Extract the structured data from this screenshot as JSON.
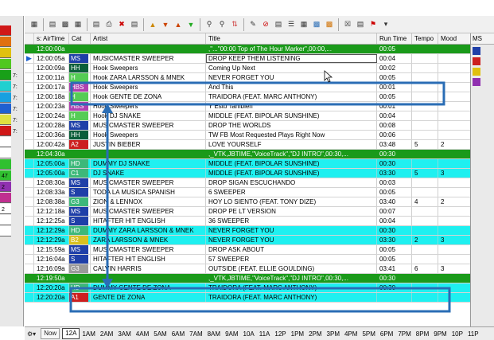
{
  "colors": {
    "green": "#1a9a1a",
    "cyan": "#1ff0f0",
    "annotation": "#2a6db5"
  },
  "columns": {
    "airtime": "s: AirTime",
    "cat": "Cat",
    "artist": "Artist",
    "title": "Title",
    "run": "Run Time",
    "tempo": "Tempo",
    "mood": "Mood"
  },
  "left_panel": {
    "labels": [
      "7:",
      "7:",
      "7:",
      "7:",
      "7:",
      "7:",
      "47",
      "2",
      "2"
    ]
  },
  "rows": [
    {
      "type": "green",
      "time": "12:00:00a",
      "cat": "",
      "cat_color": "",
      "artist": "",
      "title": ",\"...\"00:00 Top of The Hour Marker\",00:00,...",
      "run": "00:05",
      "tempo": "",
      "mood": "",
      "arrow": false,
      "title_box": false
    },
    {
      "type": "white",
      "time": "12:00:05a",
      "cat": "MS",
      "cat_color": "#1f3fa8",
      "artist": "MUSICMASTER SWEEPER",
      "title": "DROP KEEP THEM LISTENING",
      "run": "00:04",
      "tempo": "",
      "mood": "",
      "arrow": true,
      "title_box": true
    },
    {
      "type": "white",
      "time": "12:00:09a",
      "cat": "HH",
      "cat_color": "#0b5e3a",
      "artist": "Hook Sweepers",
      "title": "Coming Up Next",
      "run": "00:02",
      "tempo": "",
      "mood": "",
      "arrow": false,
      "title_box": false
    },
    {
      "type": "white",
      "time": "12:00:11a",
      "cat": "H",
      "cat_color": "#55cc55",
      "artist": "Hook ZARA LARSSON & MNEK",
      "title": "NEVER FORGET YOU",
      "run": "00:05",
      "tempo": "",
      "mood": "",
      "arrow": false,
      "title_box": false
    },
    {
      "type": "white",
      "time": "12:00:17a",
      "cat": "HBS",
      "cat_color": "#b040b0",
      "artist": "Hook Sweepers",
      "title": "And This",
      "run": "00:01",
      "tempo": "",
      "mood": "",
      "arrow": false,
      "title_box": false
    },
    {
      "type": "white",
      "time": "12:00:18a",
      "cat": "H",
      "cat_color": "#55cc55",
      "artist": "Hook GENTE DE ZONA",
      "title": "TRAIDORA (FEAT. MARC ANTHONY)",
      "run": "00:05",
      "tempo": "",
      "mood": "",
      "arrow": false,
      "title_box": false
    },
    {
      "type": "white",
      "time": "12:00:23a",
      "cat": "HBS",
      "cat_color": "#b040b0",
      "artist": "Hook Sweepers",
      "title": "Y Esto Tambien",
      "run": "00:01",
      "tempo": "",
      "mood": "",
      "arrow": false,
      "title_box": false
    },
    {
      "type": "white",
      "time": "12:00:24a",
      "cat": "H",
      "cat_color": "#55cc55",
      "artist": "Hook DJ SNAKE",
      "title": "MIDDLE (FEAT. BIPOLAR SUNSHINE)",
      "run": "00:04",
      "tempo": "",
      "mood": "",
      "arrow": false,
      "title_box": false
    },
    {
      "type": "white",
      "time": "12:00:28a",
      "cat": "MS",
      "cat_color": "#1f3fa8",
      "artist": "MUSICMASTER SWEEPER",
      "title": "DROP THE WORLDS",
      "run": "00:08",
      "tempo": "",
      "mood": "",
      "arrow": false,
      "title_box": false
    },
    {
      "type": "white",
      "time": "12:00:36a",
      "cat": "HH",
      "cat_color": "#0b5e3a",
      "artist": "Hook Sweepers",
      "title": "TW FB Most Requested Plays Right Now",
      "run": "00:06",
      "tempo": "",
      "mood": "",
      "arrow": false,
      "title_box": false
    },
    {
      "type": "white",
      "time": "12:00:42a",
      "cat": "A2",
      "cat_color": "#cc1f1f",
      "artist": "JUSTIN BIEBER",
      "title": "LOVE YOURSELF",
      "run": "03:48",
      "tempo": "5",
      "mood": "2",
      "arrow": false,
      "title_box": false
    },
    {
      "type": "green",
      "time": "12:04:30a",
      "cat": "",
      "cat_color": "",
      "artist": "",
      "title": ",_VTK,JBTIME,\"VoiceTrack\",\"DJ INTRO\",00:30,...",
      "run": "00:30",
      "tempo": "",
      "mood": "",
      "arrow": false,
      "title_box": false
    },
    {
      "type": "cyan",
      "time": "12:05:00a",
      "cat": "HD",
      "cat_color": "#3db87a",
      "artist": "DUMMY DJ SNAKE",
      "title": "MIDDLE (FEAT. BIPOLAR SUNSHINE)",
      "run": "00:30",
      "tempo": "",
      "mood": "",
      "arrow": false,
      "title_box": false
    },
    {
      "type": "cyan",
      "time": "12:05:00a",
      "cat": "C1",
      "cat_color": "#3db87a",
      "artist": "DJ SNAKE",
      "title": "MIDDLE (FEAT. BIPOLAR SUNSHINE)",
      "run": "03:30",
      "tempo": "5",
      "mood": "3",
      "arrow": false,
      "title_box": false
    },
    {
      "type": "white",
      "time": "12:08:30a",
      "cat": "MS",
      "cat_color": "#1f3fa8",
      "artist": "MUSICMASTER SWEEPER",
      "title": "DROP SIGAN ESCUCHANDO",
      "run": "00:03",
      "tempo": "",
      "mood": "",
      "arrow": false,
      "title_box": false
    },
    {
      "type": "white",
      "time": "12:08:33a",
      "cat": "S",
      "cat_color": "#1f3fa8",
      "artist": "TODA LA MUSICA SPANISH",
      "title": "6 SWEEPER",
      "run": "00:05",
      "tempo": "",
      "mood": "",
      "arrow": false,
      "title_box": false
    },
    {
      "type": "white",
      "time": "12:08:38a",
      "cat": "G3",
      "cat_color": "#3db87a",
      "artist": "ZION & LENNOX",
      "title": "HOY LO SIENTO (FEAT. TONY DIZE)",
      "run": "03:40",
      "tempo": "4",
      "mood": "2",
      "arrow": false,
      "title_box": false
    },
    {
      "type": "white",
      "time": "12:12:18a",
      "cat": "MS",
      "cat_color": "#1f3fa8",
      "artist": "MUSICMASTER SWEEPER",
      "title": "DROP PE LT VERSION",
      "run": "00:07",
      "tempo": "",
      "mood": "",
      "arrow": false,
      "title_box": false
    },
    {
      "type": "white",
      "time": "12:12:25a",
      "cat": "S",
      "cat_color": "#1f3fa8",
      "artist": "HITAFTER HIT ENGLISH",
      "title": "36 SWEEPER",
      "run": "00:04",
      "tempo": "",
      "mood": "",
      "arrow": false,
      "title_box": false
    },
    {
      "type": "cyan",
      "time": "12:12:29a",
      "cat": "HD",
      "cat_color": "#3db87a",
      "artist": "DUMMY ZARA LARSSON & MNEK",
      "title": "NEVER FORGET YOU",
      "run": "00:30",
      "tempo": "",
      "mood": "",
      "arrow": false,
      "title_box": false
    },
    {
      "type": "cyan",
      "time": "12:12:29a",
      "cat": "B2",
      "cat_color": "#d8c020",
      "artist": "ZARA LARSSON & MNEK",
      "title": "NEVER FORGET YOU",
      "run": "03:30",
      "tempo": "2",
      "mood": "3",
      "arrow": false,
      "title_box": false
    },
    {
      "type": "white",
      "time": "12:15:59a",
      "cat": "MS",
      "cat_color": "#1f3fa8",
      "artist": "MUSICMASTER SWEEPER",
      "title": "DROP ASK ABOUT",
      "run": "00:05",
      "tempo": "",
      "mood": "",
      "arrow": false,
      "title_box": false
    },
    {
      "type": "white",
      "time": "12:16:04a",
      "cat": "S",
      "cat_color": "#1f3fa8",
      "artist": "HITAFTER HIT ENGLISH",
      "title": "57 SWEEPER",
      "run": "00:05",
      "tempo": "",
      "mood": "",
      "arrow": false,
      "title_box": false
    },
    {
      "type": "white",
      "time": "12:16:09a",
      "cat": "G3",
      "cat_color": "#9a9a9a",
      "artist": "CALVIN HARRIS",
      "title": "OUTSIDE (FEAT. ELLIE GOULDING)",
      "run": "03:41",
      "tempo": "6",
      "mood": "3",
      "arrow": false,
      "title_box": false
    },
    {
      "type": "green",
      "time": "12:19:50a",
      "cat": "",
      "cat_color": "",
      "artist": "",
      "title": ",_VTK,JBTIME,\"VoiceTrack\",\"DJ INTRO\",00:30,...",
      "run": "00:30",
      "tempo": "",
      "mood": "",
      "arrow": false,
      "title_box": false
    },
    {
      "type": "cyan",
      "time": "12:20:20a",
      "cat": "HD",
      "cat_color": "#3db87a",
      "artist": "DUMMY GENTE DE ZONA",
      "title": "TRAIDORA (FEAT. MARC ANTHONY)",
      "run": "00:30",
      "tempo": "",
      "mood": "",
      "arrow": false,
      "title_box": false
    },
    {
      "type": "cyan",
      "time": "12:20:20a",
      "cat": "A1",
      "cat_color": "#cc1f1f",
      "artist": "GENTE DE ZONA",
      "title": "TRAIDORA (FEAT. MARC ANTHONY)",
      "run": "",
      "tempo": "",
      "mood": "",
      "arrow": false,
      "title_box": false
    }
  ],
  "right_panel": {
    "header": "MS",
    "labels": [
      "MS",
      "HH",
      "H",
      "HBS"
    ]
  },
  "bottom": {
    "now": "Now",
    "hours": [
      "12A",
      "1AM",
      "2AM",
      "3AM",
      "4AM",
      "5AM",
      "6AM",
      "7AM",
      "8AM",
      "9AM",
      "10A",
      "11A",
      "12P",
      "1PM",
      "2PM",
      "3PM",
      "4PM",
      "5PM",
      "6PM",
      "7PM",
      "8PM",
      "9PM",
      "10P",
      "11P"
    ],
    "selected": "12A"
  }
}
